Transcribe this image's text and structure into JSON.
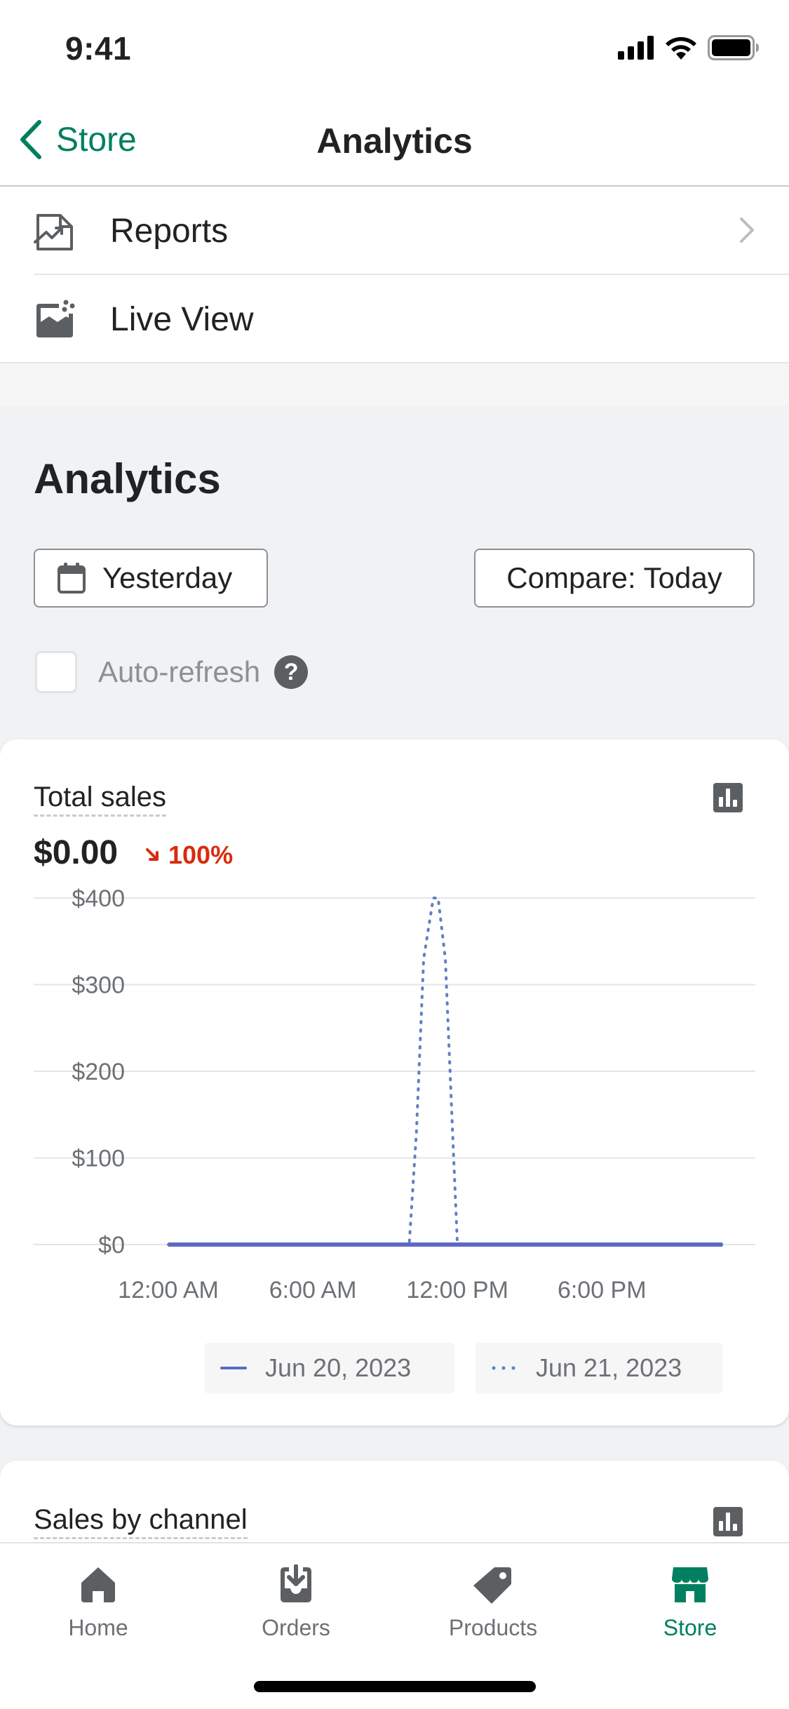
{
  "status_bar": {
    "time": "9:41"
  },
  "nav": {
    "back_label": "Store",
    "title": "Analytics"
  },
  "menu": {
    "items": [
      {
        "label": "Reports",
        "icon": "reports-icon"
      },
      {
        "label": "Live View",
        "icon": "live-view-icon"
      }
    ]
  },
  "analytics": {
    "heading": "Analytics",
    "date_button_label": "Yesterday",
    "compare_button_label": "Compare: Today",
    "auto_refresh_label": "Auto-refresh",
    "auto_refresh_checked": false
  },
  "total_sales_card": {
    "title": "Total sales",
    "value": "$0.00",
    "change": "100%",
    "change_direction": "down",
    "change_color": "#d72c0d"
  },
  "chart_data": {
    "type": "line",
    "y_tick_labels": [
      "$400",
      "$300",
      "$200",
      "$100",
      "$0"
    ],
    "x_tick_labels": [
      "12:00 AM",
      "6:00 AM",
      "12:00 PM",
      "6:00 PM"
    ],
    "ylim": [
      0,
      400
    ],
    "xlim": [
      0,
      23
    ],
    "grid": true,
    "legend_position": "bottom",
    "series": [
      {
        "name": "Jun 20, 2023",
        "style": "solid",
        "color": "#5c6ac4",
        "x": [
          0,
          23
        ],
        "y": [
          0,
          0
        ]
      },
      {
        "name": "Jun 21, 2023",
        "style": "dotted",
        "color": "#5e81c0",
        "x": [
          0,
          10,
          10.3,
          10.6,
          11,
          11.2,
          11.5,
          11.8,
          12,
          23
        ],
        "y": [
          0,
          0,
          130,
          330,
          400,
          400,
          330,
          130,
          0,
          0
        ]
      }
    ]
  },
  "channel_card": {
    "title": "Sales by channel"
  },
  "tabs": [
    {
      "label": "Home",
      "icon": "home-icon",
      "active": false
    },
    {
      "label": "Orders",
      "icon": "orders-icon",
      "active": false
    },
    {
      "label": "Products",
      "icon": "products-tag-icon",
      "active": false
    },
    {
      "label": "Store",
      "icon": "store-icon",
      "active": true
    }
  ],
  "colors": {
    "accent": "#008060",
    "back_link": "#007f5f",
    "icon_gray": "#5c5f62"
  }
}
